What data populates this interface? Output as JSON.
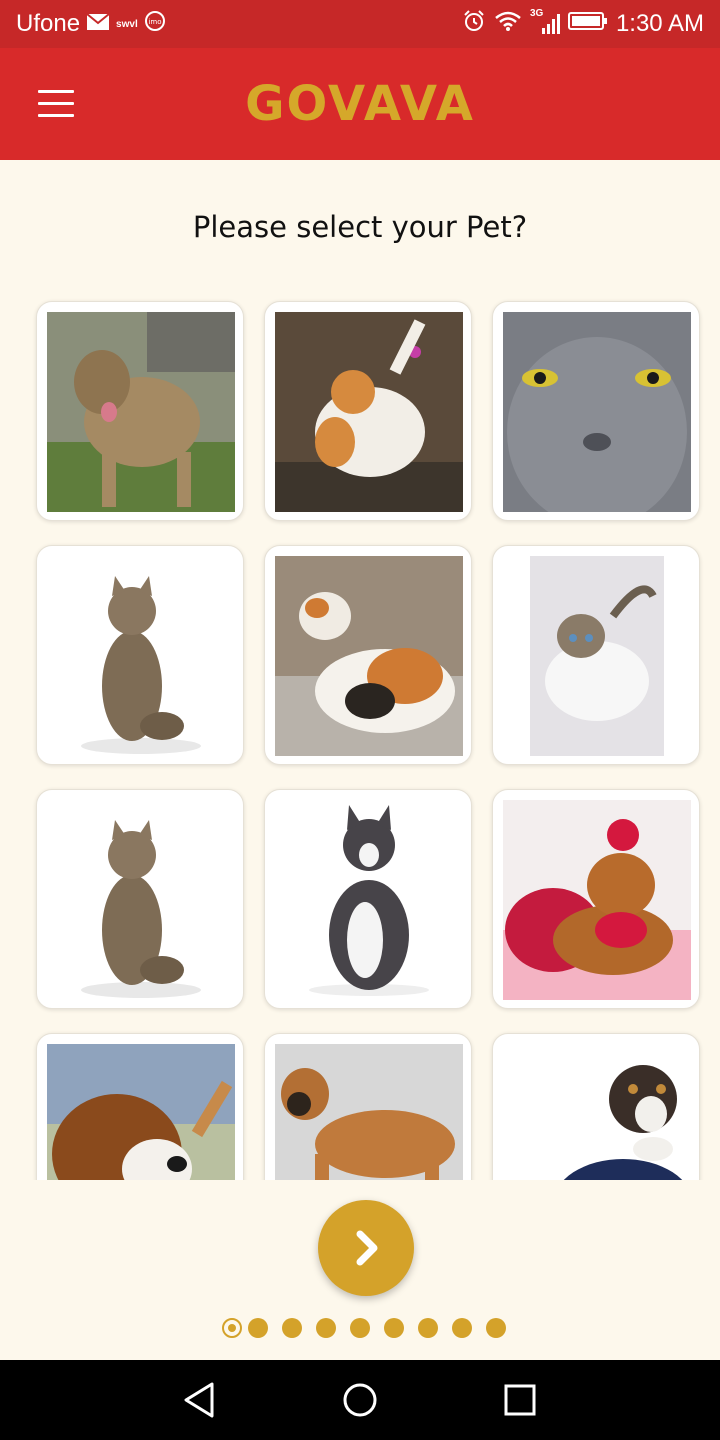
{
  "status": {
    "carrier": "Ufone",
    "mini_label_1": "swvl",
    "mini_label_2": "imo",
    "network": "3G",
    "time": "1:30 AM"
  },
  "app": {
    "title": "GOVAVA",
    "brand_color": "#d5a82a",
    "bar_color": "#d82a2a"
  },
  "content": {
    "prompt": "Please select your Pet?"
  },
  "pets": [
    {
      "icon": "dog-brindle"
    },
    {
      "icon": "cat-orange-white"
    },
    {
      "icon": "cat-grey-closeup"
    },
    {
      "icon": "cat-tabby-sitting"
    },
    {
      "icon": "cat-calico-lying"
    },
    {
      "icon": "cat-white-tabby-lying"
    },
    {
      "icon": "cat-tabby-sitting"
    },
    {
      "icon": "cat-black-white"
    },
    {
      "icon": "cat-orange-red-dress"
    },
    {
      "icon": "dog-beagle"
    },
    {
      "icon": "dog-mastiff-snow"
    },
    {
      "icon": "dog-aussie-sweater"
    }
  ],
  "pager": {
    "total": 9,
    "active_index": 0
  },
  "accent_color": "#d4a22a"
}
